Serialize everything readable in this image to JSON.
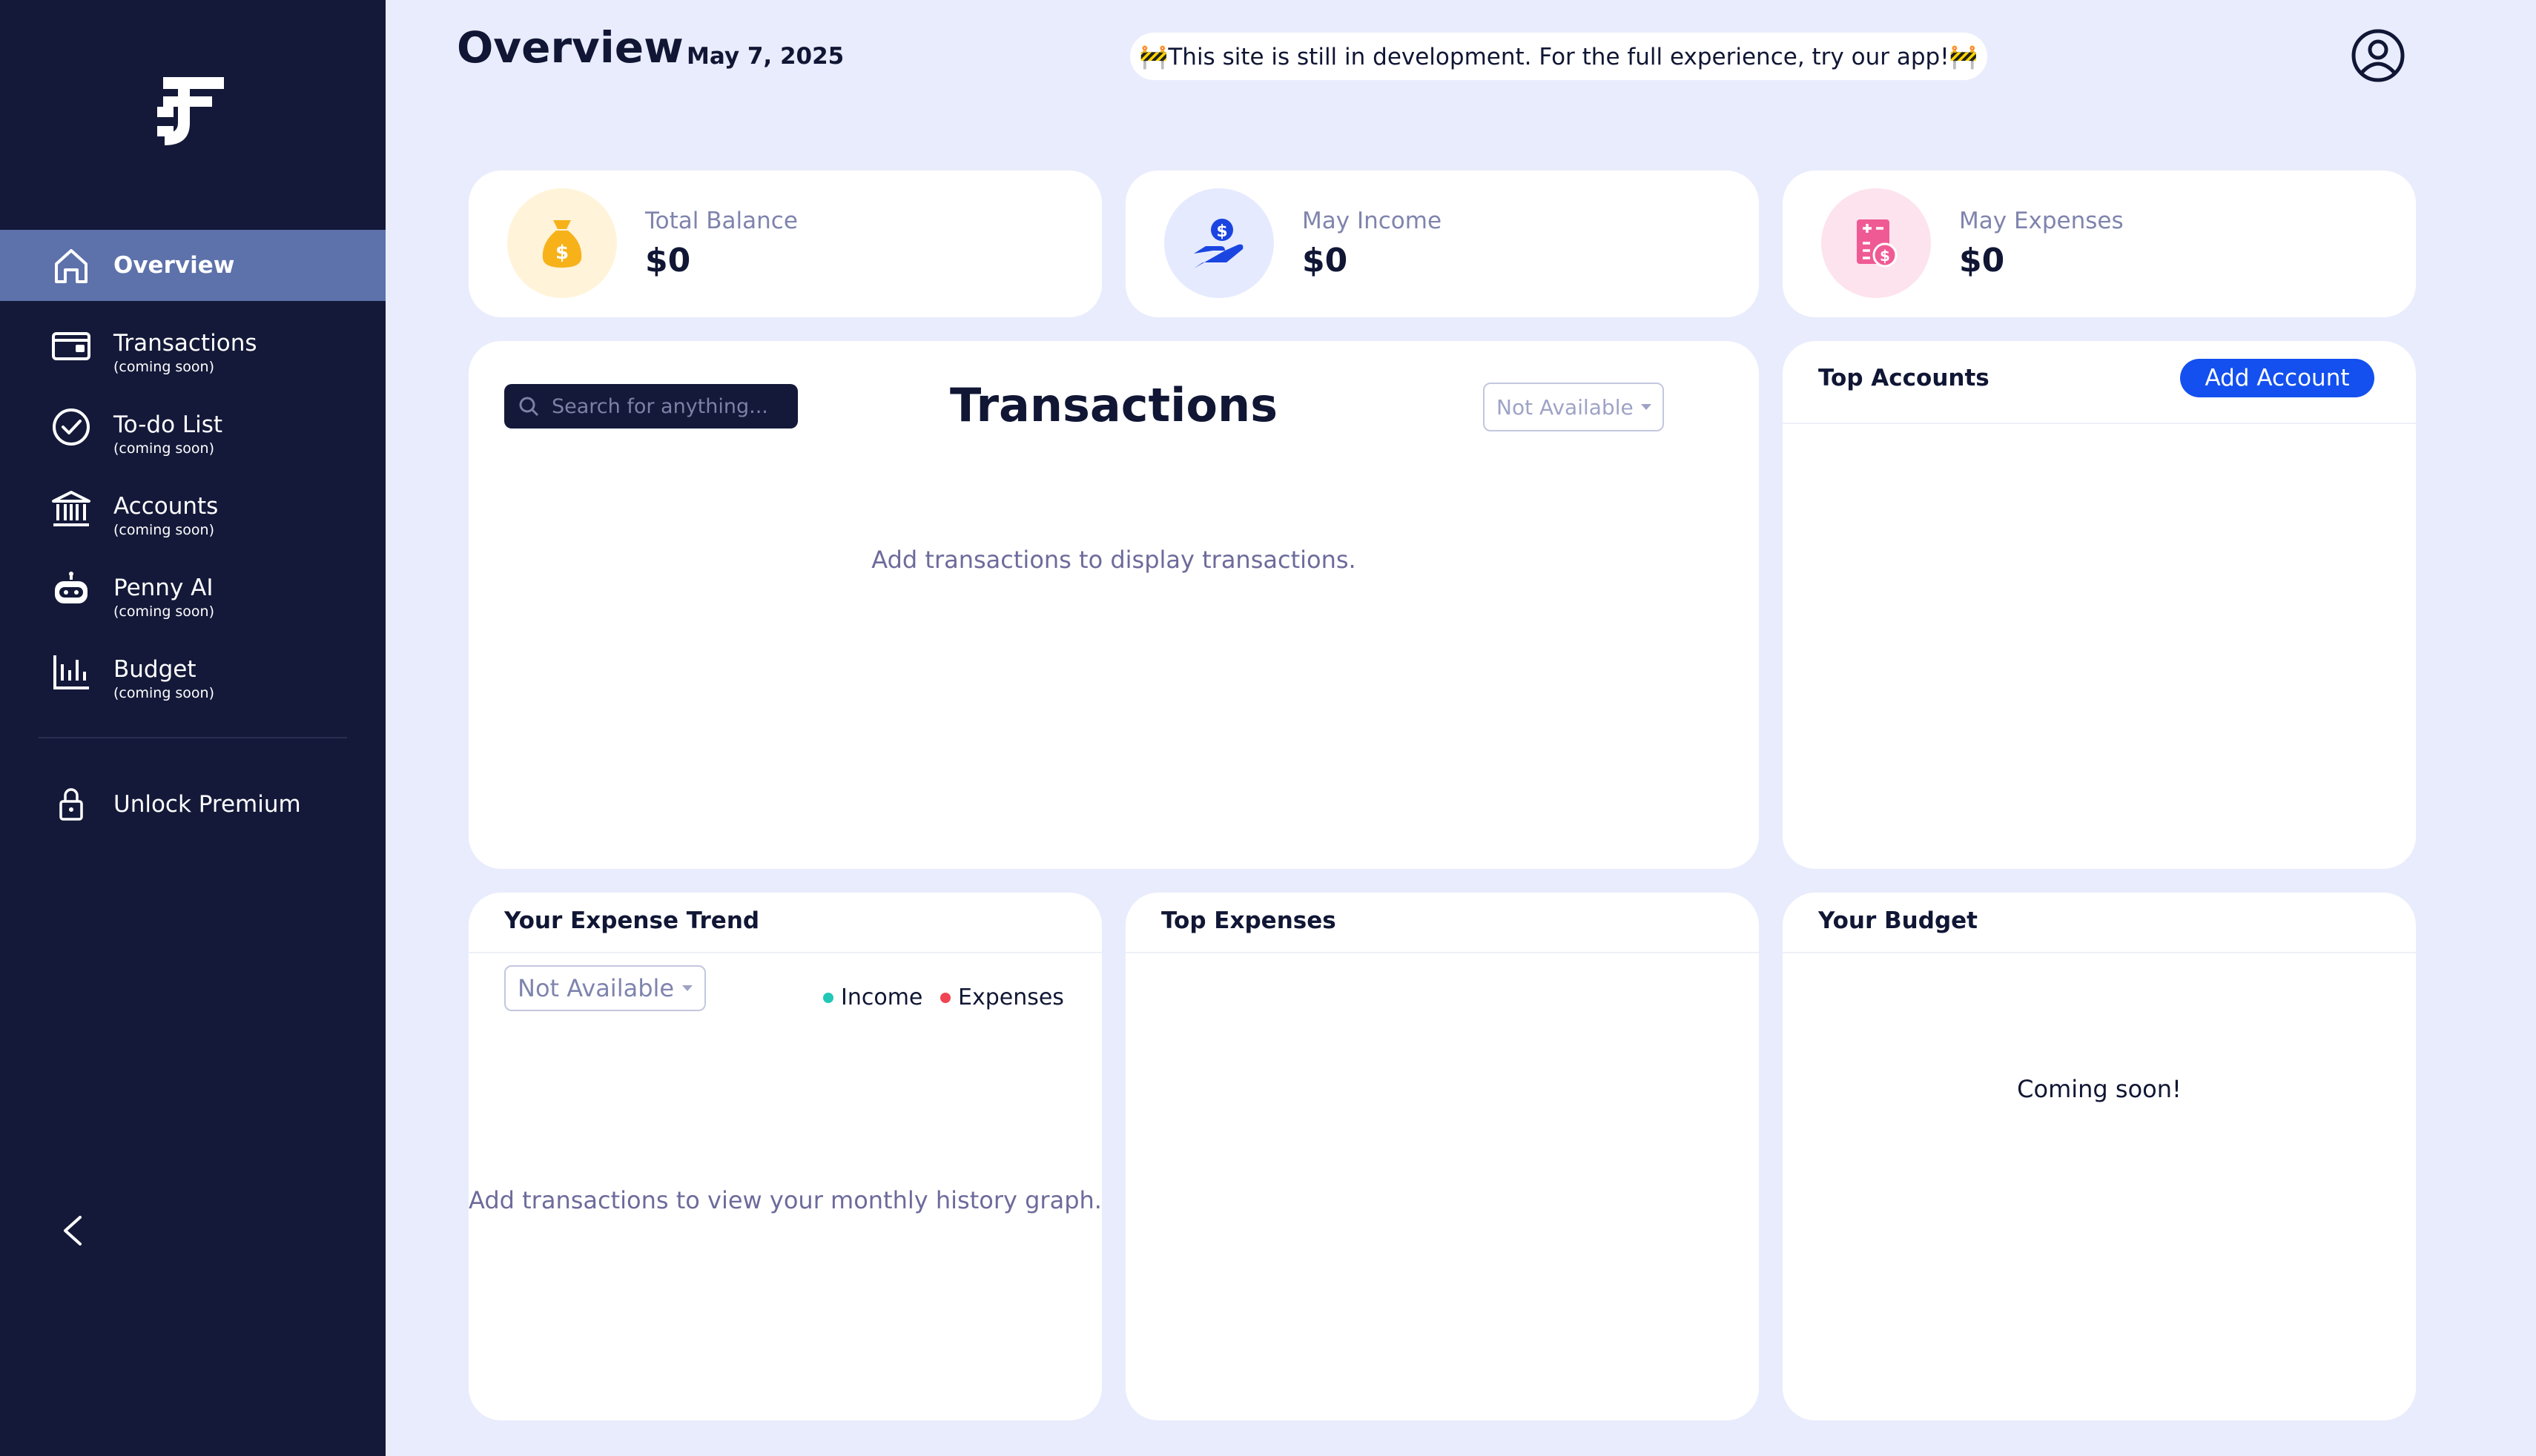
{
  "sidebar": {
    "logo": "finance-app-logo",
    "items": [
      {
        "label": "Overview",
        "sub": "",
        "icon": "home-icon"
      },
      {
        "label": "Transactions",
        "sub": "(coming soon)",
        "icon": "wallet-icon"
      },
      {
        "label": "To-do List",
        "sub": "(coming soon)",
        "icon": "check-circle-icon"
      },
      {
        "label": "Accounts",
        "sub": "(coming soon)",
        "icon": "bank-icon"
      },
      {
        "label": "Penny AI",
        "sub": "(coming soon)",
        "icon": "robot-icon"
      },
      {
        "label": "Budget",
        "sub": "(coming soon)",
        "icon": "bar-chart-icon"
      }
    ],
    "premium": {
      "label": "Unlock Premium",
      "icon": "lock-icon"
    },
    "collapse_icon": "chevron-left-icon"
  },
  "header": {
    "title": "Overview",
    "date": "May 7, 2025",
    "banner": "🚧This site is still in development. For the full experience, try our app!🚧",
    "profile_icon": "user-circle-icon"
  },
  "stats": [
    {
      "label": "Total Balance",
      "value": "$0",
      "icon": "money-bag-icon",
      "color": "#f7b21a",
      "bg": "#fff3d9"
    },
    {
      "label": "May Income",
      "value": "$0",
      "icon": "hand-dollar-icon",
      "color": "#1a45e0",
      "bg": "#e6eaff"
    },
    {
      "label": "May Expenses",
      "value": "$0",
      "icon": "receipt-icon",
      "color": "#f05a94",
      "bg": "#fde3ee"
    }
  ],
  "transactions": {
    "search_placeholder": "Search for anything...",
    "title": "Transactions",
    "filter": "Not Available",
    "empty": "Add transactions to display transactions."
  },
  "top_accounts": {
    "title": "Top Accounts",
    "add_button": "Add Account"
  },
  "expense_trend": {
    "title": "Your Expense Trend",
    "filter": "Not Available",
    "legend": [
      {
        "label": "Income",
        "color": "#22c7b5"
      },
      {
        "label": "Expenses",
        "color": "#f04452"
      }
    ],
    "empty": "Add transactions to view your monthly history graph."
  },
  "top_expenses": {
    "title": "Top Expenses"
  },
  "budget": {
    "title": "Your Budget",
    "message": "Coming soon!"
  }
}
